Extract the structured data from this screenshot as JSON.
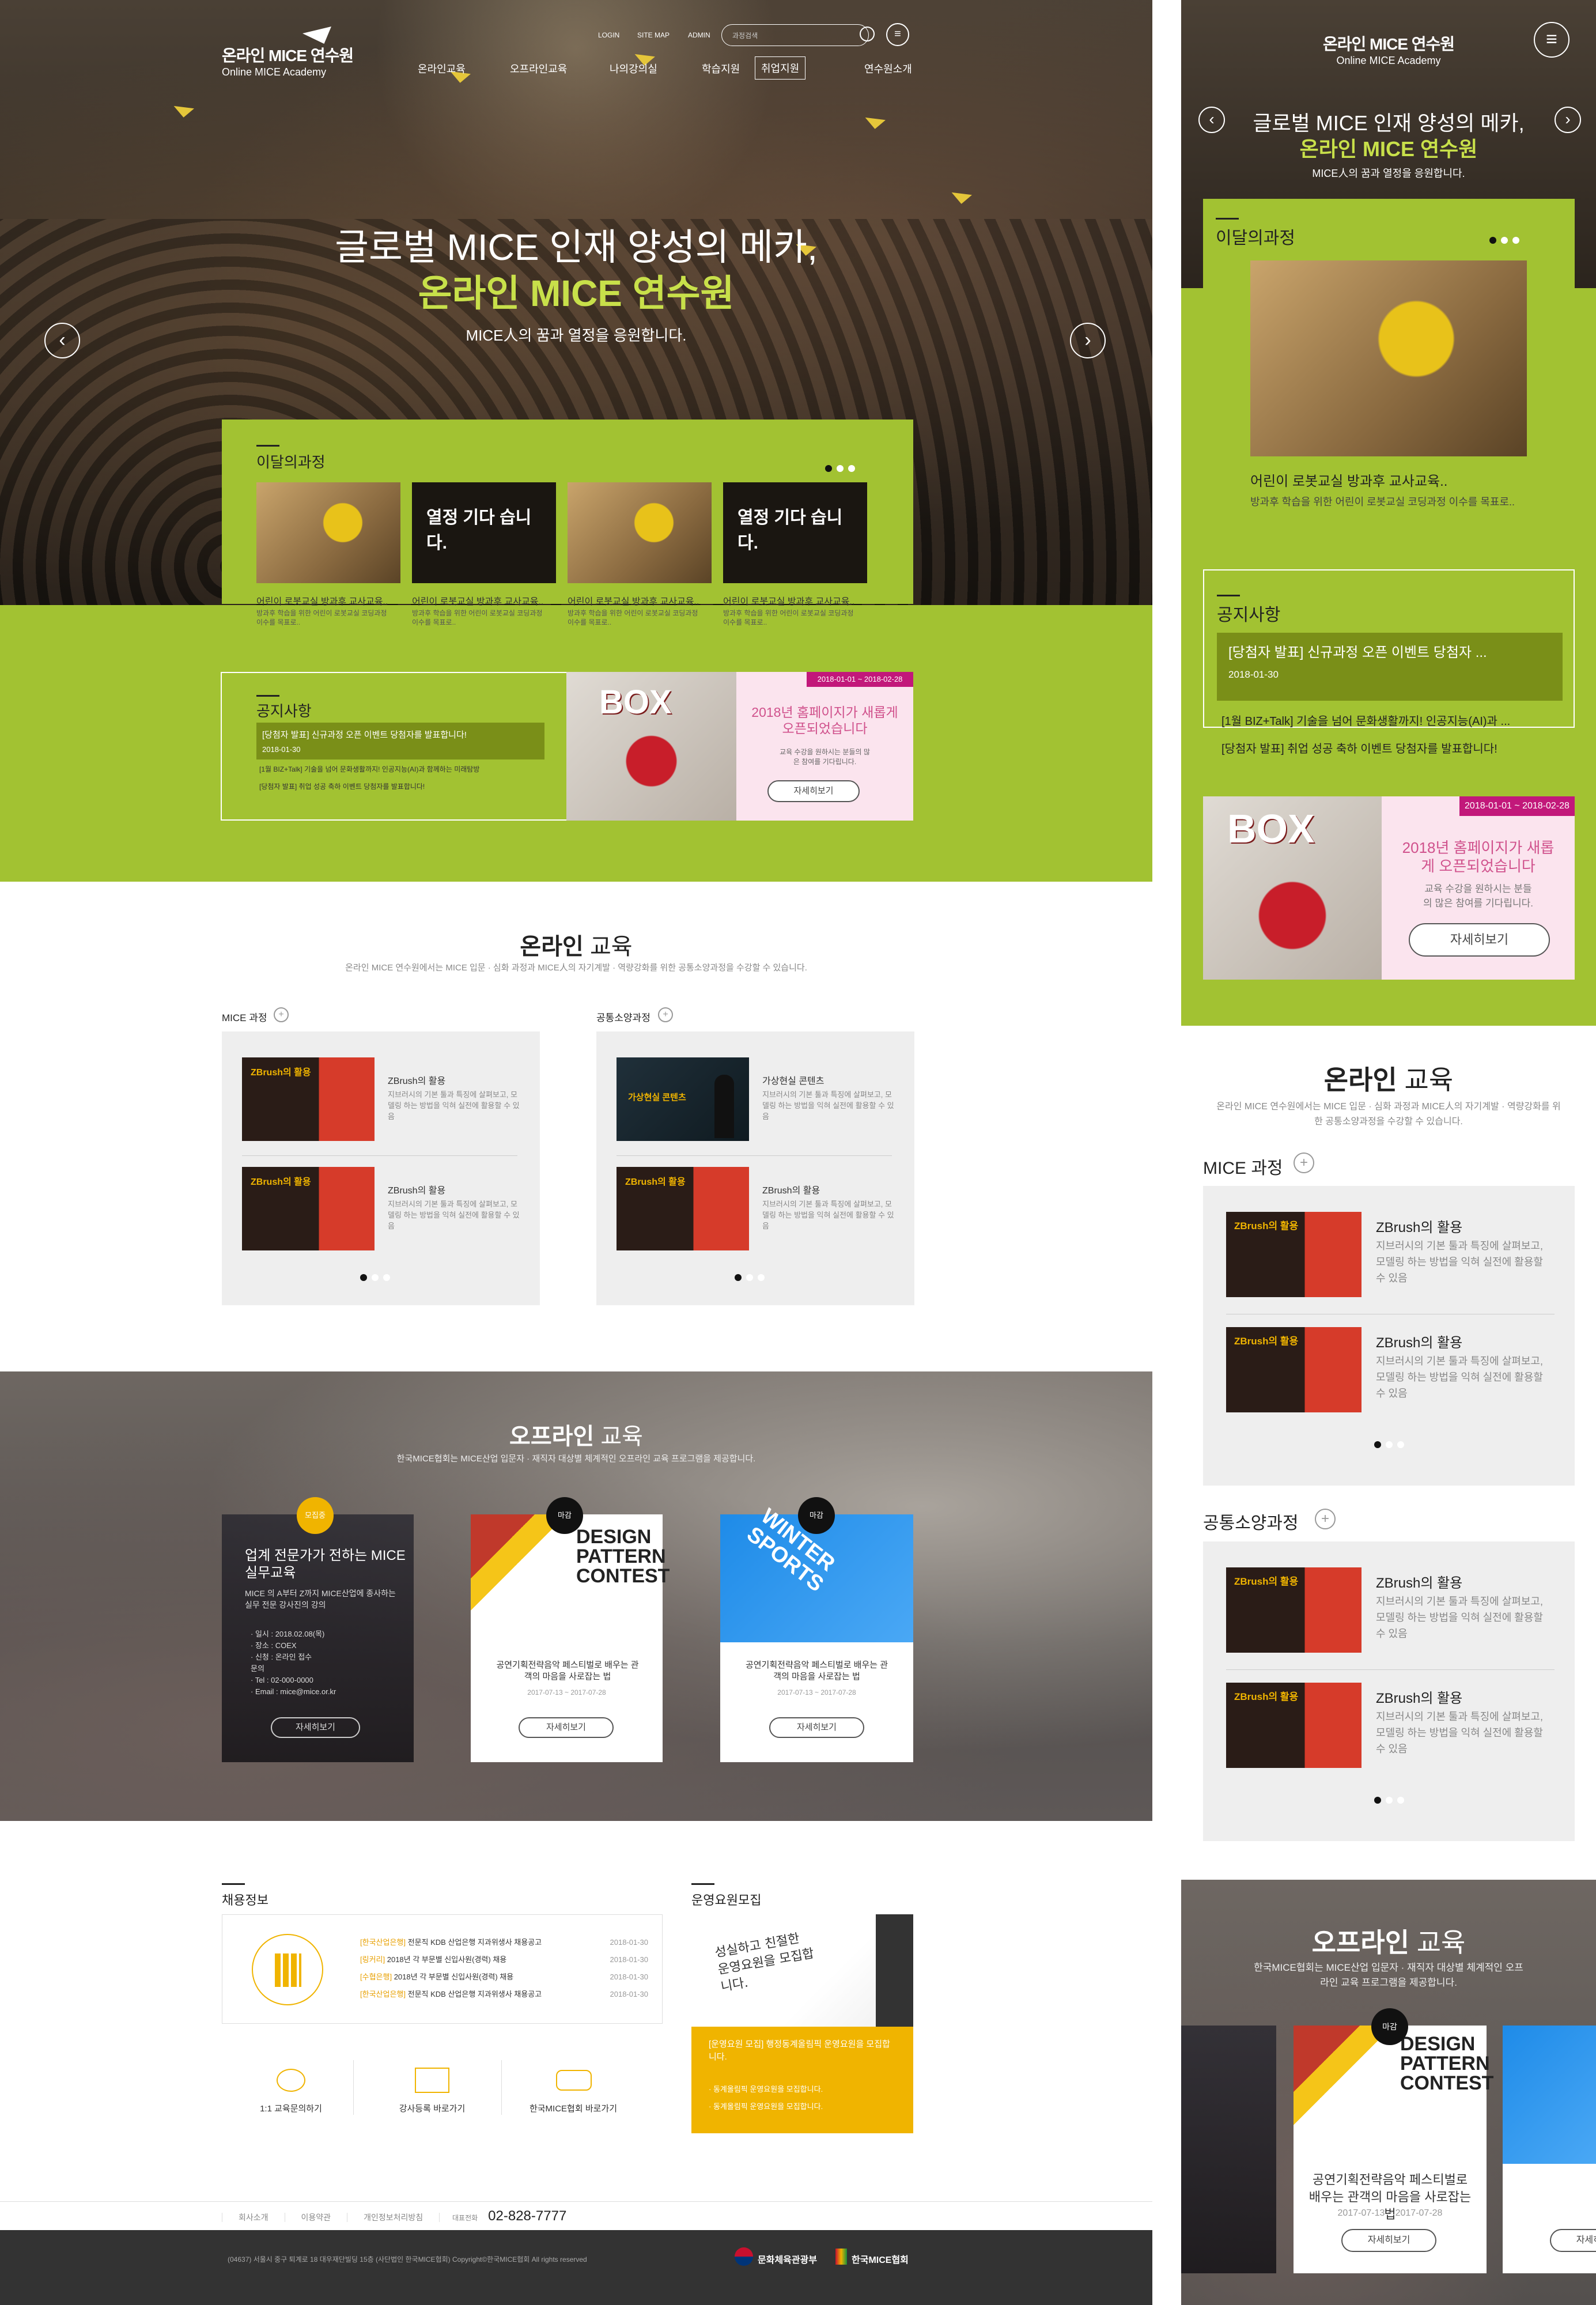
{
  "brand": {
    "name": "온라인 MICE 연수원",
    "sub": "Online MICE Academy"
  },
  "top_links": [
    "LOGIN",
    "SITE MAP",
    "ADMIN"
  ],
  "search": {
    "placeholder": "과정검색"
  },
  "nav": [
    "온라인교육",
    "오프라인교육",
    "나의강의실",
    "학습지원",
    "취업지원",
    "연수원소개"
  ],
  "hero": {
    "title": "글로벌 MICE 인재 양성의 메카,",
    "title2": "온라인 MICE 연수원",
    "sub": "MICE人의 꿈과 열정을 응원합니다."
  },
  "monthly": {
    "title": "이달의과정",
    "items": [
      {
        "thumb": "robot",
        "name": "어린이 로봇교실 방과후 교사교육..",
        "desc": "방과후 학습을 위한 어린이 로봇교실 코딩과정 이수를 목표로.."
      },
      {
        "thumb": "waiting",
        "thumb_text": "열정 기다 습니다.",
        "name": "어린이 로봇교실 방과후 교사교육..",
        "desc": "방과후 학습을 위한 어린이 로봇교실 코딩과정 이수를 목표로.."
      },
      {
        "thumb": "robot",
        "name": "어린이 로봇교실 방과후 교사교육..",
        "desc": "방과후 학습을 위한 어린이 로봇교실 코딩과정 이수를 목표로.."
      },
      {
        "thumb": "waiting",
        "thumb_text": "열정 기다 습니다.",
        "name": "어린이 로봇교실 방과후 교사교육..",
        "desc": "방과후 학습을 위한 어린이 로봇교실 코딩과정 이수를 목표로.."
      }
    ]
  },
  "notice": {
    "title": "공지사항",
    "featured": "[당첨자 발표] 신규과정 오픈 이벤트 당첨자를 발표합니다!",
    "featured_mobile": "[당첨자 발표] 신규과정 오픈 이벤트 당첨자 ...",
    "date": "2018-01-30",
    "items": [
      "[1월 BIZ+Talk] 기술을 넘어 문화생활까지! 인공지능(AI)과 함께하는 미래탐방",
      "[당첨자 발표] 취업 성공 축하 이벤트 당첨자를 발표합니다!"
    ],
    "items_mobile": [
      "[1월 BIZ+Talk] 기술을 넘어 문화생활까지! 인공지능(AI)과 ...",
      "[당첨자 발표] 취업 성공 축하 이벤트 당첨자를 발표합니다!"
    ]
  },
  "banner": {
    "period": "2018-01-01 ~ 2018-02-28",
    "box": "BOX",
    "title": "2018년 홈페이지가 새롭게 오픈되었습니다",
    "desc": "교육 수강을 원하시는 분들의 많은 참여를 기다립니다.",
    "button": "자세히보기"
  },
  "online": {
    "title_a": "온라인",
    "title_b": "교육",
    "desc": "온라인 MICE 연수원에서는 MICE 입문 · 심화 과정과 MICE人의 자기계발 · 역량강화를 위한 공통소양과정을 수강할 수 있습니다.",
    "mice": {
      "label": "MICE 과정",
      "items": [
        {
          "name": "ZBrush의 활용",
          "desc": "지브러시의 기본 툴과 특징에 살펴보고, 모델링 하는 방법을 익혀 실전에 활용할 수 있음"
        },
        {
          "name": "ZBrush의 활용",
          "desc": "지브러시의 기본 툴과 특징에 살펴보고, 모델링 하는 방법을 익혀 실전에 활용할 수 있음"
        }
      ]
    },
    "common": {
      "label": "공통소양과정",
      "items": [
        {
          "name": "가상현실 콘텐츠",
          "desc": "지브러시의 기본 툴과 특징에 살펴보고, 모델링 하는 방법을 익혀 실전에 활용할 수 있음"
        },
        {
          "name": "ZBrush의 활용",
          "desc": "지브러시의 기본 툴과 특징에 살펴보고, 모델링 하는 방법을 익혀 실전에 활용할 수 있음"
        }
      ]
    },
    "zb_thumb": "ZBrush의 활용",
    "vr_thumb": "가상현실 콘텐츠"
  },
  "offline": {
    "title_a": "오프라인",
    "title_b": "교육",
    "desc": "한국MICE협회는 MICE산업 입문자 · 재직자 대상별 체계적인 오프라인 교육 프로그램을 제공합니다.",
    "card1": {
      "badge": "모집중",
      "title": "업계 전문가가 전하는 MICE 실무교육",
      "desc": "MICE 의 A부터 Z까지 MICE산업에 종사하는 실무 전문 강사진의 강의",
      "info": [
        "· 일시 : 2018.02.08(목)",
        "· 장소 : COEX",
        "· 신청 : 온라인 접수",
        "  문의",
        "· Tel : 02-000-0000",
        "· Email : mice@mice.or.kr"
      ],
      "button": "자세히보기"
    },
    "card2": {
      "badge": "마감",
      "img": "DESIGN PATTERN CONTEST",
      "title": "공연기획전략음악 페스티벌로 배우는 관객의 마음을 사로잡는 법",
      "date": "2017-07-13 ~ 2017-07-28",
      "button": "자세히보기"
    },
    "card3": {
      "badge": "마감",
      "img": "WINTER SPORTS",
      "title": "공연기획전략음악 페스티벌로 배우는 관객의 마음을 사로잡는 법",
      "date": "2017-07-13 ~ 2017-07-28",
      "button": "자세히보기"
    }
  },
  "jobs": {
    "title": "채용정보",
    "items": [
      {
        "tag": "[한국산업은행]",
        "text": "전문직 KDB 산업은행 지과위생사 채용공고",
        "date": "2018-01-30"
      },
      {
        "tag": "[링커리]",
        "text": "2018년 각 부문별 신입사원(경력) 채용",
        "date": "2018-01-30"
      },
      {
        "tag": "[수협은행]",
        "text": "2018년 각 부문별 신입사원(경력) 채용",
        "date": "2018-01-30"
      },
      {
        "tag": "[한국산업은행]",
        "text": "전문직 KDB 산업은행 지과위생사 채용공고",
        "date": "2018-01-30"
      }
    ]
  },
  "recruit": {
    "title": "운영요원모집",
    "img_text": "성실하고 친절한 운영요원을 모집합니다.",
    "highlight": "[운영요원 모집] 행정동계올림픽 운영요원을 모집합니다.",
    "items": [
      "· 동계올림픽 운영요원을 모집합니다.",
      "· 동계올림픽 운영요원을 모집합니다."
    ]
  },
  "quick": [
    "1:1 교육문의하기",
    "강사등록 바로가기",
    "한국MICE협회 바로가기"
  ],
  "footer": {
    "links": [
      "회사소개",
      "이용약관",
      "개인정보처리방침"
    ],
    "tel_label": "대표전화",
    "tel": "02-828-7777",
    "address": "(04637) 서울시 중구 퇴계로 18 대우재단빌딩 15층 (사단법인 한국MICE협회) Copyright©한국MICE협회 All rights reserved",
    "logo1": "문화체육관광부",
    "logo2": "한국MICE협회"
  },
  "colors": {
    "green": "#a2c232",
    "dark_green": "#7a8f18",
    "orange": "#f0b400",
    "footer": "#333333",
    "pink": "#c2187a"
  }
}
